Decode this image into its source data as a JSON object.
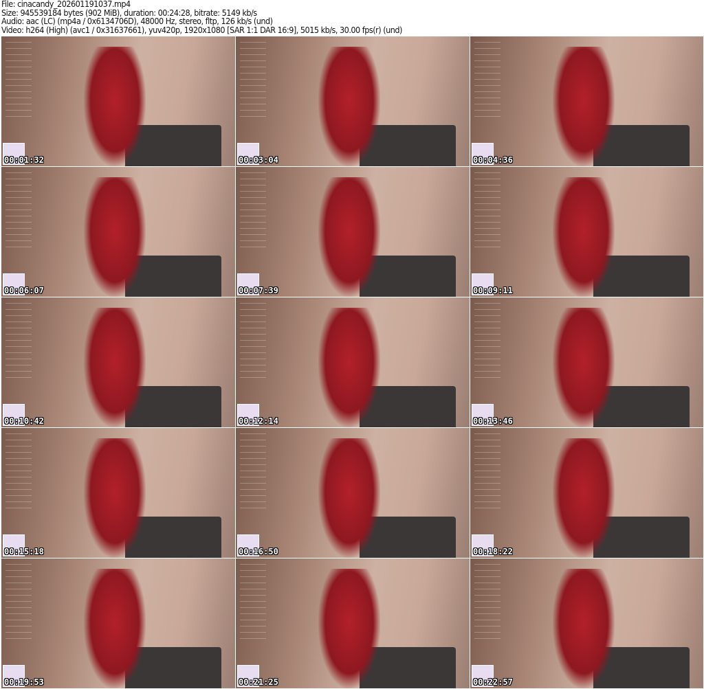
{
  "header": {
    "file": "File: cinacandy_202601191037.mp4",
    "size": "Size: 945539184 bytes (902 MiB), duration: 00:24:28, bitrate: 5149 kb/s",
    "audio": "Audio: aac (LC) (mp4a / 0x6134706D), 48000 Hz, stereo, fltp, 126 kb/s (und)",
    "video": "Video: h264 (High) (avc1 / 0x31637661), yuv420p, 1920x1080 [SAR 1:1 DAR 16:9], 5015 kb/s, 30.00 fps(r) (und)"
  },
  "thumbnails": [
    {
      "timestamp": "00:01:32"
    },
    {
      "timestamp": "00:03:04"
    },
    {
      "timestamp": "00:04:36"
    },
    {
      "timestamp": "00:06:07"
    },
    {
      "timestamp": "00:07:39"
    },
    {
      "timestamp": "00:09:11"
    },
    {
      "timestamp": "00:10:42"
    },
    {
      "timestamp": "00:12:14"
    },
    {
      "timestamp": "00:13:46"
    },
    {
      "timestamp": "00:15:18"
    },
    {
      "timestamp": "00:16:50"
    },
    {
      "timestamp": "00:18:22"
    },
    {
      "timestamp": "00:19:53"
    },
    {
      "timestamp": "00:21:25"
    },
    {
      "timestamp": "00:22:57"
    }
  ]
}
